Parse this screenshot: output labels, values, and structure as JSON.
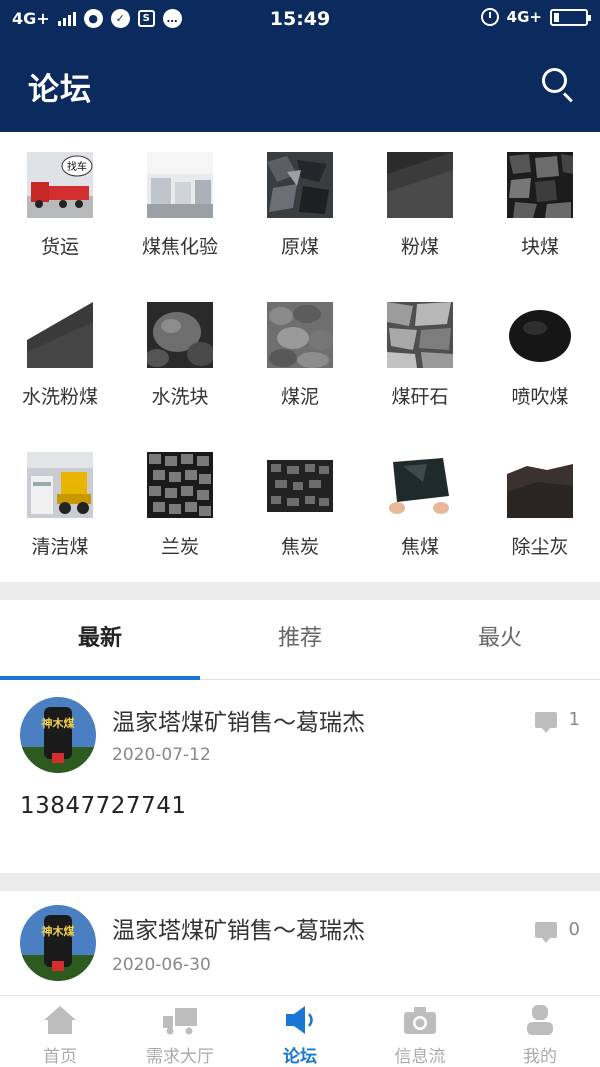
{
  "status_bar": {
    "network_left": "4G+",
    "time": "15:49",
    "network_right": "4G+"
  },
  "header": {
    "title": "论坛",
    "search_icon": "search-icon"
  },
  "categories": [
    {
      "label": "货运",
      "icon": "truck-photo"
    },
    {
      "label": "煤焦化验",
      "icon": "lab-photo"
    },
    {
      "label": "原煤",
      "icon": "raw-coal-photo"
    },
    {
      "label": "粉煤",
      "icon": "powder-coal-photo"
    },
    {
      "label": "块煤",
      "icon": "lump-coal-photo"
    },
    {
      "label": "水洗粉煤",
      "icon": "washed-powder-coal-photo"
    },
    {
      "label": "水洗块",
      "icon": "washed-lump-photo"
    },
    {
      "label": "煤泥",
      "icon": "coal-slime-photo"
    },
    {
      "label": "煤矸石",
      "icon": "gangue-photo"
    },
    {
      "label": "喷吹煤",
      "icon": "injection-coal-photo"
    },
    {
      "label": "清洁煤",
      "icon": "clean-coal-photo"
    },
    {
      "label": "兰炭",
      "icon": "semi-coke-photo"
    },
    {
      "label": "焦炭",
      "icon": "coke-photo"
    },
    {
      "label": "焦煤",
      "icon": "coking-coal-photo"
    },
    {
      "label": "除尘灰",
      "icon": "dust-ash-photo"
    }
  ],
  "truck_sign": "找车",
  "tabs": [
    {
      "label": "最新",
      "active": true
    },
    {
      "label": "推荐",
      "active": false
    },
    {
      "label": "最火",
      "active": false
    }
  ],
  "posts": [
    {
      "author": "温家塔煤矿销售～葛瑞杰",
      "date": "2020-07-12",
      "comments": "1",
      "body": "13847727741"
    },
    {
      "author": "温家塔煤矿销售～葛瑞杰",
      "date": "2020-06-30",
      "comments": "0",
      "body": ""
    }
  ],
  "avatar_text": "神木煤",
  "bottom_nav": [
    {
      "label": "首页",
      "icon": "home-icon",
      "active": false
    },
    {
      "label": "需求大厅",
      "icon": "truck-icon",
      "active": false
    },
    {
      "label": "论坛",
      "icon": "speaker-icon",
      "active": true
    },
    {
      "label": "信息流",
      "icon": "camera-icon",
      "active": false
    },
    {
      "label": "我的",
      "icon": "user-icon",
      "active": false
    }
  ],
  "colors": {
    "header_bg": "#0b2a5e",
    "accent": "#1976d2",
    "separator": "#ececec"
  }
}
